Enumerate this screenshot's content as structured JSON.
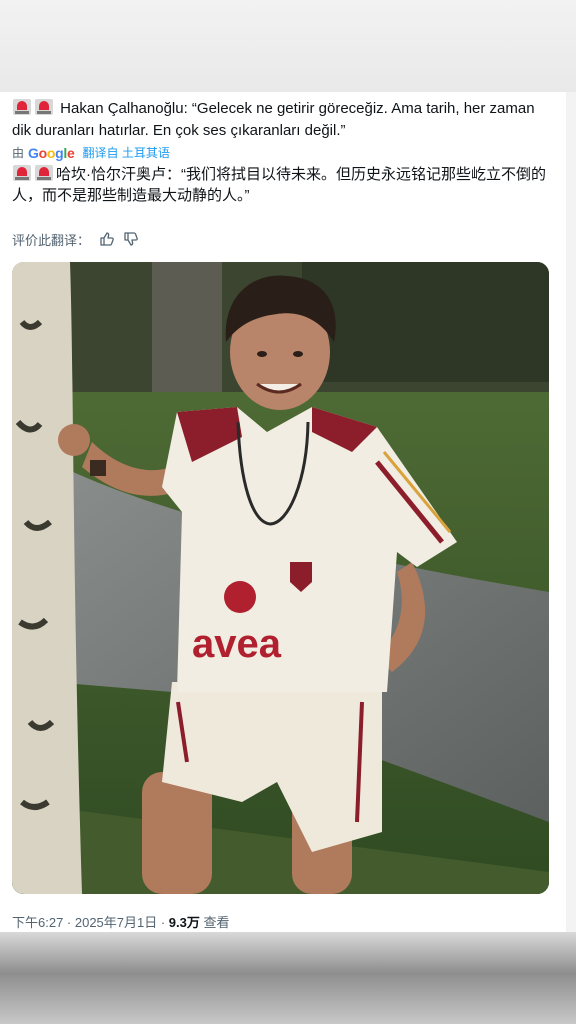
{
  "tweet": {
    "original_text": "Hakan Çalhanoğlu: “Gelecek ne getirir göreceğiz. Ama tarih, her zaman dik duranları hatırlar. En çok ses çıkaranları değil.”",
    "translate_bar": {
      "prefix": "由",
      "brand": "Google",
      "link": "翻译自 土耳其语"
    },
    "translated_text": "哈坎·恰尔汗奥卢：“我们将拭目以待未来。但历史永远铭记那些屹立不倒的人，而不是那些制造最大动静的人。”",
    "rate_label": "评价此翻译：",
    "timestamp": "下午6:27 · 2025年7月1日 · ",
    "views_count": "9.3万",
    "views_label": " 查看",
    "icons": [
      "police-siren-icon",
      "thumbs-up-icon",
      "thumbs-down-icon"
    ],
    "jersey_text": "avea"
  }
}
